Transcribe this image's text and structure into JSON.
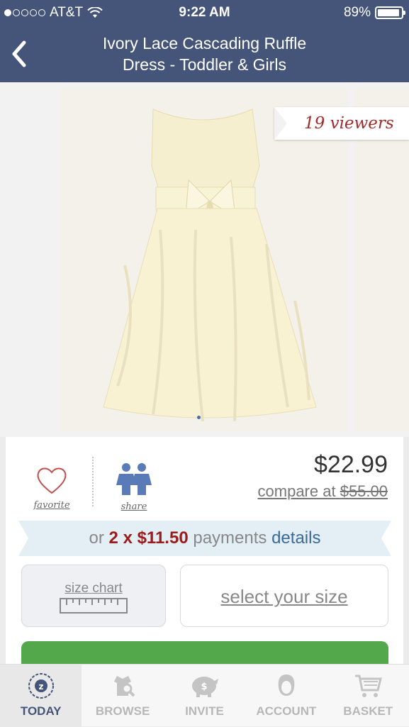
{
  "status": {
    "carrier": "AT&T",
    "time": "9:22 AM",
    "battery": "89%",
    "signal_bars_filled": 1,
    "signal_bars_total": 5
  },
  "nav": {
    "title_line1": "Ivory Lace Cascading Ruffle",
    "title_line2": "Dress - Toddler & Girls",
    "back_icon": "chevron-left-icon"
  },
  "product": {
    "viewers_badge": "19 viewers",
    "favorite_label": "favorite",
    "share_label": "share",
    "price": "$22.99",
    "compare_label": "compare at",
    "compare_price": "$55.00",
    "payments": {
      "prefix": "or",
      "amount": "2 x $11.50",
      "suffix": "payments",
      "details": "details"
    },
    "size_chart_label": "size chart",
    "select_size_label": "select your size"
  },
  "tabs": [
    {
      "label": "TODAY",
      "icon": "zulily-logo-icon",
      "active": true
    },
    {
      "label": "BROWSE",
      "icon": "browse-icon",
      "active": false
    },
    {
      "label": "INVITE",
      "icon": "piggy-bank-icon",
      "active": false
    },
    {
      "label": "ACCOUNT",
      "icon": "person-icon",
      "active": false
    },
    {
      "label": "BASKET",
      "icon": "cart-icon",
      "active": false
    }
  ],
  "colors": {
    "nav": "#45557a",
    "price_accent": "#9b1b1b",
    "button_green": "#52a84a",
    "link_blue": "#3a6a9a"
  }
}
